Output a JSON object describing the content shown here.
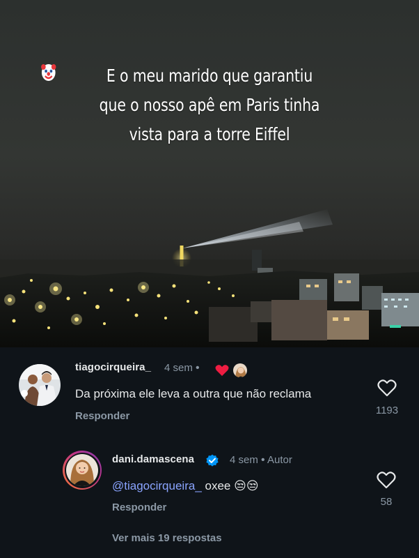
{
  "post": {
    "caption_lines": [
      "E o meu marido que garantiu",
      "que o nosso apê em Paris tinha",
      "vista para a torre Eiffel"
    ],
    "caption_emoji": "clown-face"
  },
  "comments": [
    {
      "username": "tiagocirqueira_",
      "time": "4 sem",
      "separator": "•",
      "text": "Da próxima ele leva a outra que não reclama",
      "reply_label": "Responder",
      "likes": "1193",
      "liked_by_author": true
    },
    {
      "username": "dani.damascena",
      "verified": true,
      "time": "4 sem",
      "separator": "•",
      "author_label": "Autor",
      "mention": "@tiagocirqueira_",
      "text": " oxee 😒😒",
      "reply_label": "Responder",
      "likes": "58"
    }
  ],
  "more_replies_label": "Ver mais 19 respostas",
  "colors": {
    "background": "#0f1419",
    "text": "#e7e9ea",
    "muted": "#8b98a5",
    "mention": "#8aa4ff",
    "heart": "#ee1d42",
    "verified": "#0095f6",
    "story_ring_start": "#c13584",
    "story_ring_end": "#f77737"
  }
}
